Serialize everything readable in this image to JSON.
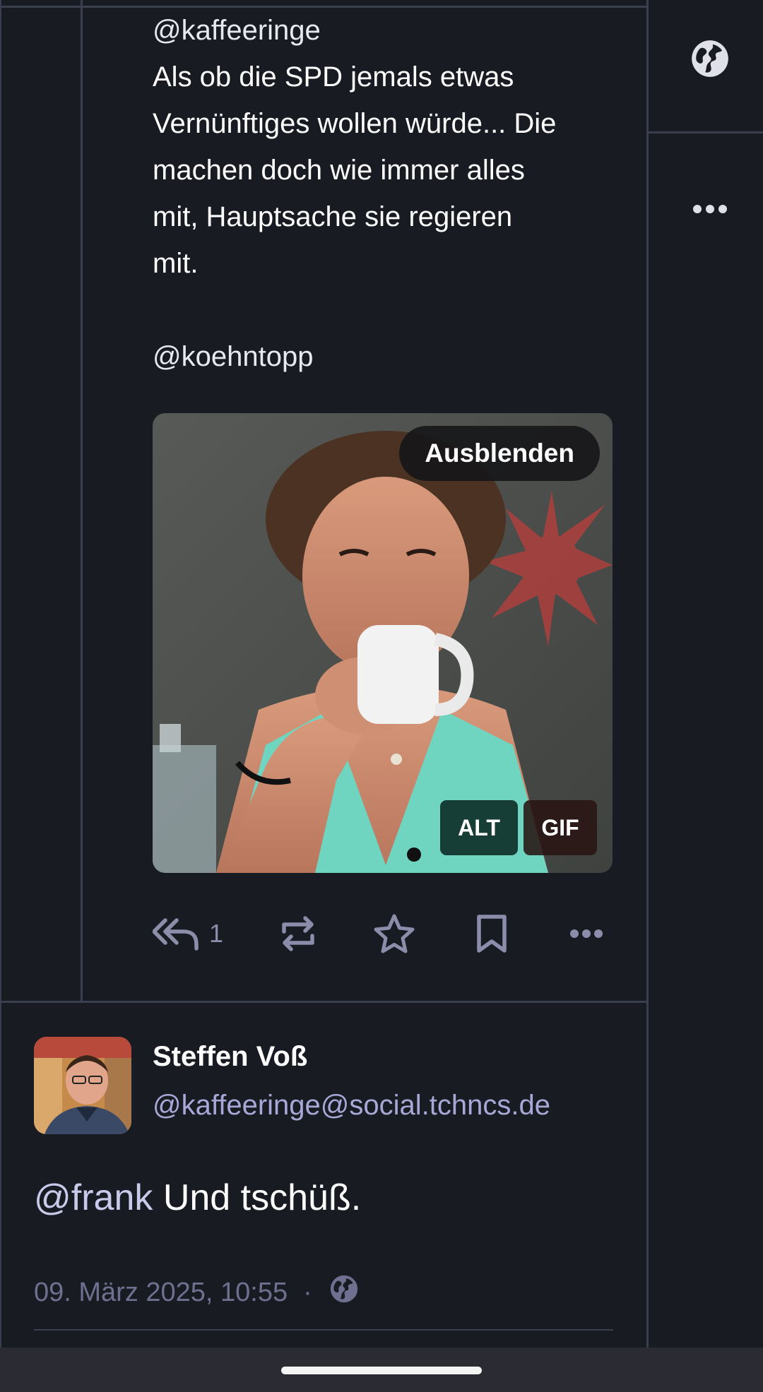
{
  "quoted_post": {
    "mention_top": "@kaffeeringe",
    "body_lines": [
      "Als ob die SPD jemals etwas",
      "Vernünftiges wollen würde... Die",
      "machen doch wie immer alles",
      "mit, Hauptsache sie regieren",
      "mit."
    ],
    "body_mention": "@koehntopp",
    "media": {
      "hide_label": "Ausblenden",
      "alt_badge": "ALT",
      "gif_badge": "GIF"
    },
    "actions": {
      "reply_icon": "reply-all-icon",
      "reply_count": "1",
      "boost_icon": "boost-icon",
      "favourite_icon": "star-icon",
      "bookmark_icon": "bookmark-icon",
      "more_icon": "more-horizontal-icon"
    }
  },
  "right_rail": {
    "visibility_icon": "globe-icon",
    "more_icon": "more-horizontal-icon"
  },
  "reply_post": {
    "display_name": "Steffen Voß",
    "handle": "@kaffeeringe@social.tchncs.de",
    "mention": "@frank",
    "text": " Und tschüß.",
    "timestamp": "09. März 2025, 10:55",
    "separator": "·",
    "visibility_icon": "globe-icon"
  },
  "colors": {
    "background": "#191b22",
    "divider": "#393f4f",
    "icon_muted": "#8c8dab",
    "handle": "#a7a8d8",
    "timestamp": "#6f7090"
  }
}
